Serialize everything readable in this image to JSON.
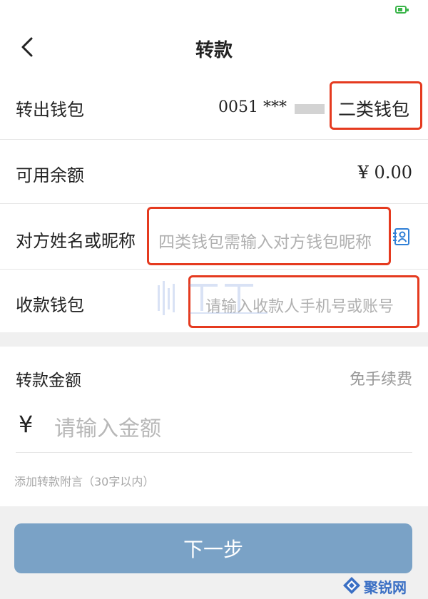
{
  "header": {
    "title": "转款"
  },
  "rows": {
    "from_wallet": {
      "label": "转出钱包",
      "account": "0051 ***",
      "wallet_type": "二类钱包"
    },
    "balance": {
      "label": "可用余额",
      "value": "¥ 0.00"
    },
    "recipient_name": {
      "label": "对方姓名或昵称",
      "placeholder": "四类钱包需输入对方钱包昵称"
    },
    "receive_wallet": {
      "label": "收款钱包",
      "placeholder": "请输入收款人手机号或账号"
    }
  },
  "amount": {
    "label": "转款金额",
    "fee_note": "免手续费",
    "currency": "¥",
    "placeholder": "请输入金额",
    "remark": "添加转款附言（30字以内）"
  },
  "footer": {
    "next_label": "下一步"
  },
  "branding": {
    "logo_text": "聚锐网"
  },
  "colors": {
    "highlight": "#e53a1f",
    "button": "#7aa2c6",
    "accent_icon": "#2f7fd6",
    "battery": "#3bb54a"
  },
  "icons": {
    "back": "chevron-left-icon",
    "contact": "contact-card-icon",
    "battery": "battery-icon"
  }
}
